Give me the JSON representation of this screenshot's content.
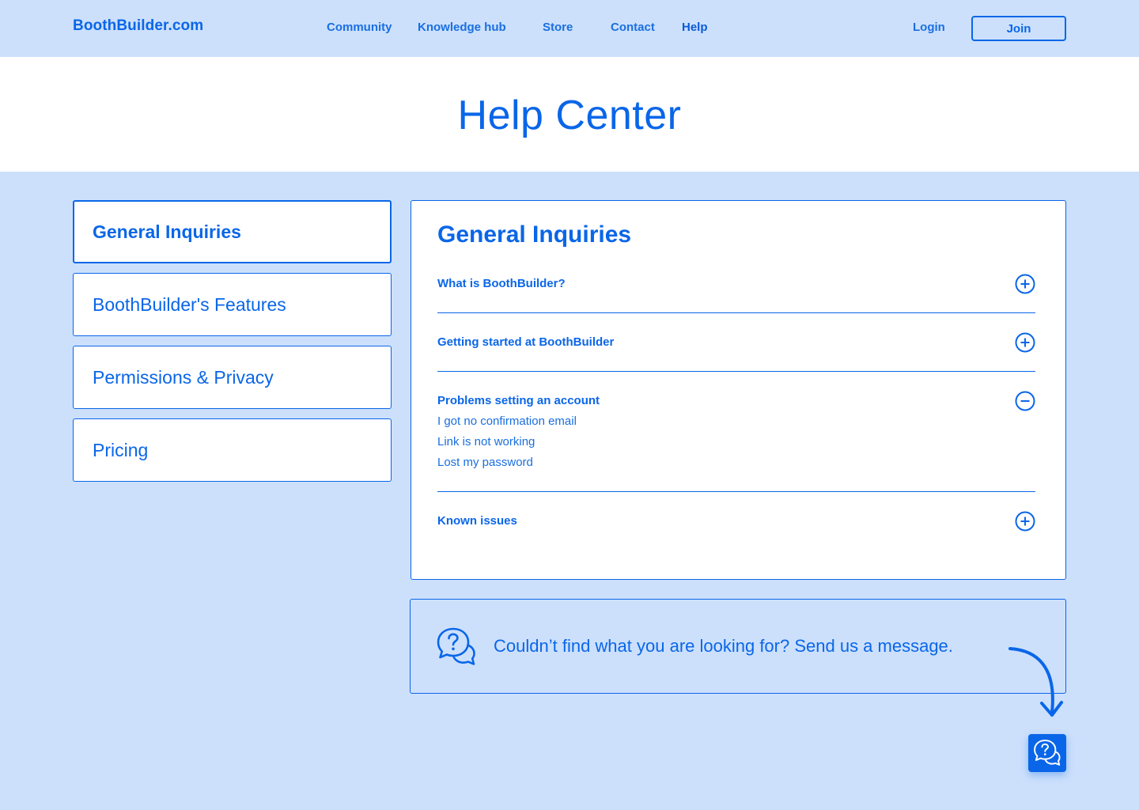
{
  "header": {
    "logo": "BoothBuilder.com",
    "nav": [
      "Community",
      "Knowledge hub",
      "Store",
      "Contact",
      "Help"
    ],
    "login": "Login",
    "join": "Join"
  },
  "hero": {
    "title": "Help Center"
  },
  "sidebar": {
    "categories": [
      {
        "label": "General Inquiries",
        "active": true
      },
      {
        "label": "BoothBuilder's Features",
        "active": false
      },
      {
        "label": "Permissions & Privacy",
        "active": false
      },
      {
        "label": "Pricing",
        "active": false
      }
    ]
  },
  "faq": {
    "title": "General Inquiries",
    "items": [
      {
        "question": "What is BoothBuilder?",
        "expanded": false,
        "answers": []
      },
      {
        "question": "Getting started at BoothBuilder",
        "expanded": false,
        "answers": []
      },
      {
        "question": "Problems setting an account",
        "expanded": true,
        "answers": [
          "I got no confirmation email",
          "Link is not working",
          "Lost my password"
        ]
      },
      {
        "question": "Known issues",
        "expanded": false,
        "answers": []
      }
    ]
  },
  "contact": {
    "message": "Couldn’t find what you are looking for? Send us a message."
  },
  "colors": {
    "accent": "#0a66e8",
    "background": "#cce0fc",
    "surface": "#ffffff"
  },
  "icons": [
    "plus-circle-icon",
    "minus-circle-icon",
    "chat-question-icon",
    "curved-arrow-icon"
  ]
}
